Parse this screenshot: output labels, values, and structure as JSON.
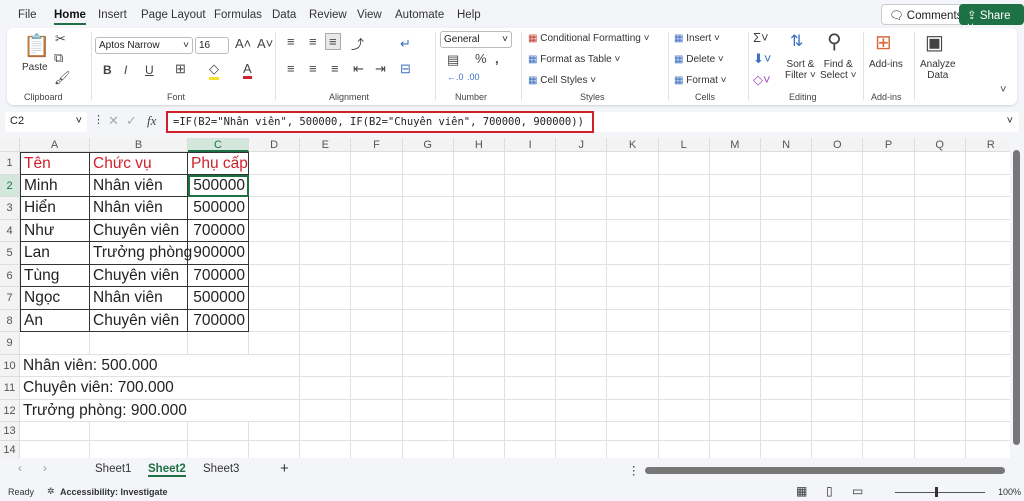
{
  "menu": [
    "File",
    "Home",
    "Insert",
    "Page Layout",
    "Formulas",
    "Data",
    "Review",
    "View",
    "Automate",
    "Help"
  ],
  "top_buttons": {
    "comments": "Comments",
    "share": "Share"
  },
  "ribbon": {
    "clipboard": {
      "paste": "Paste",
      "label": "Clipboard"
    },
    "font": {
      "name": "Aptos Narrow",
      "size": "16",
      "label": "Font"
    },
    "alignment": {
      "label": "Alignment"
    },
    "number": {
      "format": "General",
      "label": "Number"
    },
    "styles": {
      "conditional": "Conditional Formatting",
      "format_table": "Format as Table",
      "cell_styles": "Cell Styles",
      "label": "Styles"
    },
    "cells": {
      "insert": "Insert",
      "delete": "Delete",
      "format": "Format",
      "label": "Cells"
    },
    "editing": {
      "sort": "Sort &",
      "sort2": "Filter",
      "find": "Find &",
      "find2": "Select",
      "label": "Editing"
    },
    "addins": {
      "button": "Add-ins",
      "label": "Add-ins"
    },
    "analyze": {
      "l1": "Analyze",
      "l2": "Data"
    }
  },
  "formula_bar": {
    "name_box": "C2",
    "fx": "fx",
    "formula": "=IF(B2=\"Nhân viên\", 500000, IF(B2=\"Chuyên viên\", 700000, 900000))"
  },
  "columns": [
    "A",
    "B",
    "C",
    "D",
    "E",
    "F",
    "G",
    "H",
    "I",
    "J",
    "K",
    "L",
    "M",
    "N",
    "O",
    "P",
    "Q",
    "R"
  ],
  "rows": [
    "1",
    "2",
    "3",
    "4",
    "5",
    "6",
    "7",
    "8",
    "9",
    "10",
    "11",
    "12",
    "13",
    "14"
  ],
  "table": {
    "header": [
      "Tên",
      "Chức vụ",
      "Phụ cấp"
    ],
    "body": [
      [
        "Minh",
        "Nhân viên",
        "500000"
      ],
      [
        "Hiển",
        "Nhân viên",
        "500000"
      ],
      [
        "Như",
        "Chuyên viên",
        "700000"
      ],
      [
        "Lan",
        "Trưởng phòng",
        "900000"
      ],
      [
        "Tùng",
        "Chuyên viên",
        "700000"
      ],
      [
        "Ngọc",
        "Nhân viên",
        "500000"
      ],
      [
        "An",
        "Chuyên viên",
        "700000"
      ]
    ],
    "header_color": "#d0202a"
  },
  "notes": [
    "Nhân viên: 500.000",
    "Chuyên viên: 700.000",
    "Trưởng phòng: 900.000"
  ],
  "sheets": [
    "Sheet1",
    "Sheet2",
    "Sheet3"
  ],
  "active_sheet": "Sheet2",
  "status": {
    "ready": "Ready",
    "accessibility": "Accessibility: Investigate",
    "zoom": "100%"
  }
}
